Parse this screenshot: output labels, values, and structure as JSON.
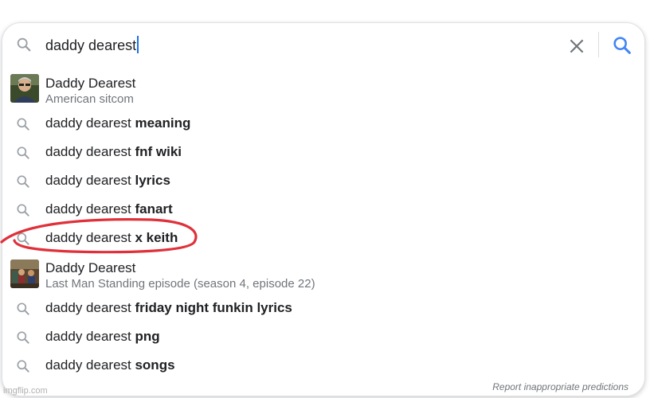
{
  "search": {
    "query": "daddy dearest",
    "clear_label": "×",
    "accent_color": "#1a73e8"
  },
  "suggestions": [
    {
      "type": "entity",
      "title": "Daddy Dearest",
      "subtitle": "American sitcom",
      "thumbnail": "man-portrait-photo"
    },
    {
      "type": "query",
      "prefix": "daddy dearest ",
      "bold": "meaning"
    },
    {
      "type": "query",
      "prefix": "daddy dearest ",
      "bold": "fnf wiki"
    },
    {
      "type": "query",
      "prefix": "daddy dearest ",
      "bold": "lyrics"
    },
    {
      "type": "query",
      "prefix": "daddy dearest ",
      "bold": "fanart"
    },
    {
      "type": "query",
      "prefix": "daddy dearest ",
      "bold": "x keith",
      "annotated": true
    },
    {
      "type": "entity",
      "title": "Daddy Dearest",
      "subtitle": "Last Man Standing episode (season 4, episode 22)",
      "thumbnail": "episode-scene-photo"
    },
    {
      "type": "query",
      "prefix": "daddy dearest ",
      "bold": "friday night funkin lyrics"
    },
    {
      "type": "query",
      "prefix": "daddy dearest ",
      "bold": "png"
    },
    {
      "type": "query",
      "prefix": "daddy dearest ",
      "bold": "songs"
    }
  ],
  "footer": {
    "report_label": "Report inappropriate predictions"
  },
  "watermark": "imgflip.com",
  "annotation_color": "#e0303a"
}
